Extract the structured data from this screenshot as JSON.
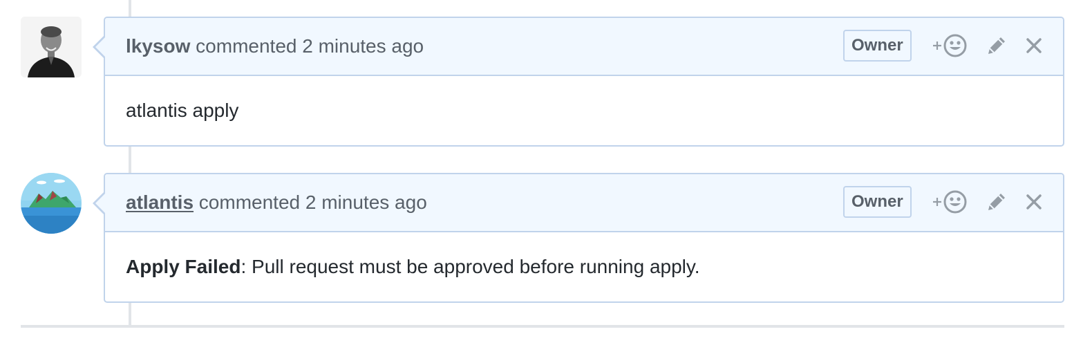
{
  "comments": [
    {
      "author": "lkysow",
      "action_text": " commented 2 minutes ago",
      "badge": "Owner",
      "body": "atlantis apply",
      "avatar_icon": "user-photo-avatar"
    },
    {
      "author": "atlantis",
      "action_text": " commented 2 minutes ago",
      "badge": "Owner",
      "body_bold": "Apply Failed",
      "body": ": Pull request must be approved before running apply.",
      "avatar_icon": "island-avatar"
    }
  ],
  "icons": {
    "reaction": "add-reaction-icon",
    "edit": "pencil-icon",
    "delete": "close-icon"
  },
  "colors": {
    "header_bg": "#f1f8ff",
    "border": "#c0d3eb",
    "muted_text": "#586069",
    "body_text": "#24292e",
    "timeline": "#e1e4e8"
  }
}
